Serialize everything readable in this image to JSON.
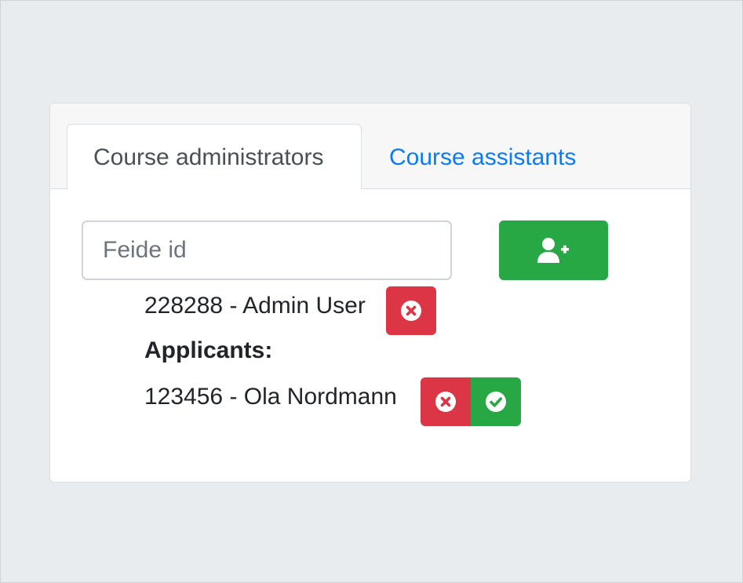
{
  "tabs": [
    {
      "label": "Course administrators",
      "active": true
    },
    {
      "label": "Course assistants",
      "active": false
    }
  ],
  "search": {
    "placeholder": "Feide id",
    "value": ""
  },
  "add_button": {
    "icon": "user-plus-icon",
    "color": "#28a745"
  },
  "administrators": [
    {
      "text": "228288 - Admin User",
      "action_icon": "times-circle-icon"
    }
  ],
  "applicants_label": "Applicants:",
  "applicants": [
    {
      "text": "123456 - Ola Nordmann",
      "actions": [
        "times-circle-icon",
        "check-circle-icon"
      ]
    }
  ],
  "colors": {
    "danger": "#dc3545",
    "success": "#28a745",
    "link": "#0d7bf0",
    "background": "#e9ecef"
  }
}
